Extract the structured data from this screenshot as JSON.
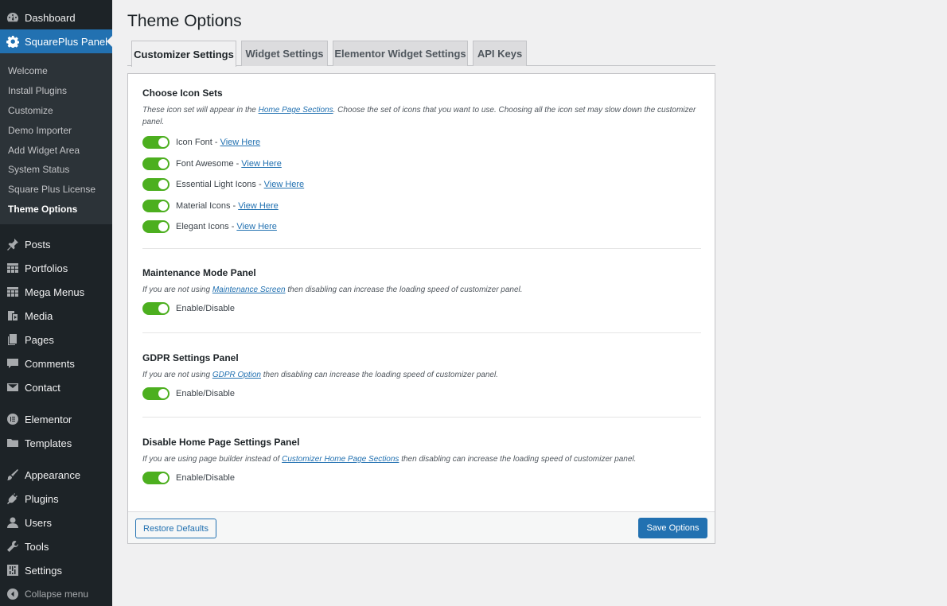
{
  "sidebar": {
    "dashboard": "Dashboard",
    "squareplus": "SquarePlus Panel",
    "submenu": [
      "Welcome",
      "Install Plugins",
      "Customize",
      "Demo Importer",
      "Add Widget Area",
      "System Status",
      "Square Plus License",
      "Theme Options"
    ],
    "items": [
      {
        "label": "Posts",
        "icon": "pin-icon"
      },
      {
        "label": "Portfolios",
        "icon": "grid-icon"
      },
      {
        "label": "Mega Menus",
        "icon": "grid-icon"
      },
      {
        "label": "Media",
        "icon": "media-icon"
      },
      {
        "label": "Pages",
        "icon": "pages-icon"
      },
      {
        "label": "Comments",
        "icon": "comment-icon"
      },
      {
        "label": "Contact",
        "icon": "mail-icon"
      }
    ],
    "items2": [
      {
        "label": "Elementor",
        "icon": "elementor-icon"
      },
      {
        "label": "Templates",
        "icon": "folder-icon"
      }
    ],
    "items3": [
      {
        "label": "Appearance",
        "icon": "brush-icon"
      },
      {
        "label": "Plugins",
        "icon": "plug-icon"
      },
      {
        "label": "Users",
        "icon": "user-icon"
      },
      {
        "label": "Tools",
        "icon": "wrench-icon"
      },
      {
        "label": "Settings",
        "icon": "settings-icon"
      }
    ],
    "collapse": "Collapse menu"
  },
  "page": {
    "title": "Theme Options"
  },
  "tabs": [
    "Customizer Settings",
    "Widget Settings",
    "Elementor Widget Settings",
    "API Keys"
  ],
  "sections": {
    "icons": {
      "title": "Choose Icon Sets",
      "desc_pre": "These icon set will appear in the ",
      "desc_link": "Home Page Sections",
      "desc_post": ". Choose the set of icons that you want to use. Choosing all the icon set may slow down the customizer panel.",
      "toggles": [
        {
          "label": "Icon Font -",
          "link": "View Here"
        },
        {
          "label": "Font Awesome -",
          "link": "View Here"
        },
        {
          "label": "Essential Light Icons -",
          "link": "View Here"
        },
        {
          "label": "Material Icons -",
          "link": "View Here"
        },
        {
          "label": "Elegant Icons -",
          "link": "View Here"
        }
      ]
    },
    "maintenance": {
      "title": "Maintenance Mode Panel",
      "desc_pre": "If you are not using ",
      "desc_link": "Maintenance Screen",
      "desc_post": " then disabling can increase the loading speed of customizer panel.",
      "toggle": "Enable/Disable"
    },
    "gdpr": {
      "title": "GDPR Settings Panel",
      "desc_pre": "If you are not using ",
      "desc_link": "GDPR Option",
      "desc_post": " then disabling can increase the loading speed of customizer panel.",
      "toggle": "Enable/Disable"
    },
    "homepage": {
      "title": "Disable Home Page Settings Panel",
      "desc_pre": "If you are using page builder instead of ",
      "desc_link": "Customizer Home Page Sections",
      "desc_post": " then disabling can increase the loading speed of customizer panel.",
      "toggle": "Enable/Disable"
    }
  },
  "footer": {
    "restore": "Restore Defaults",
    "save": "Save Options"
  }
}
